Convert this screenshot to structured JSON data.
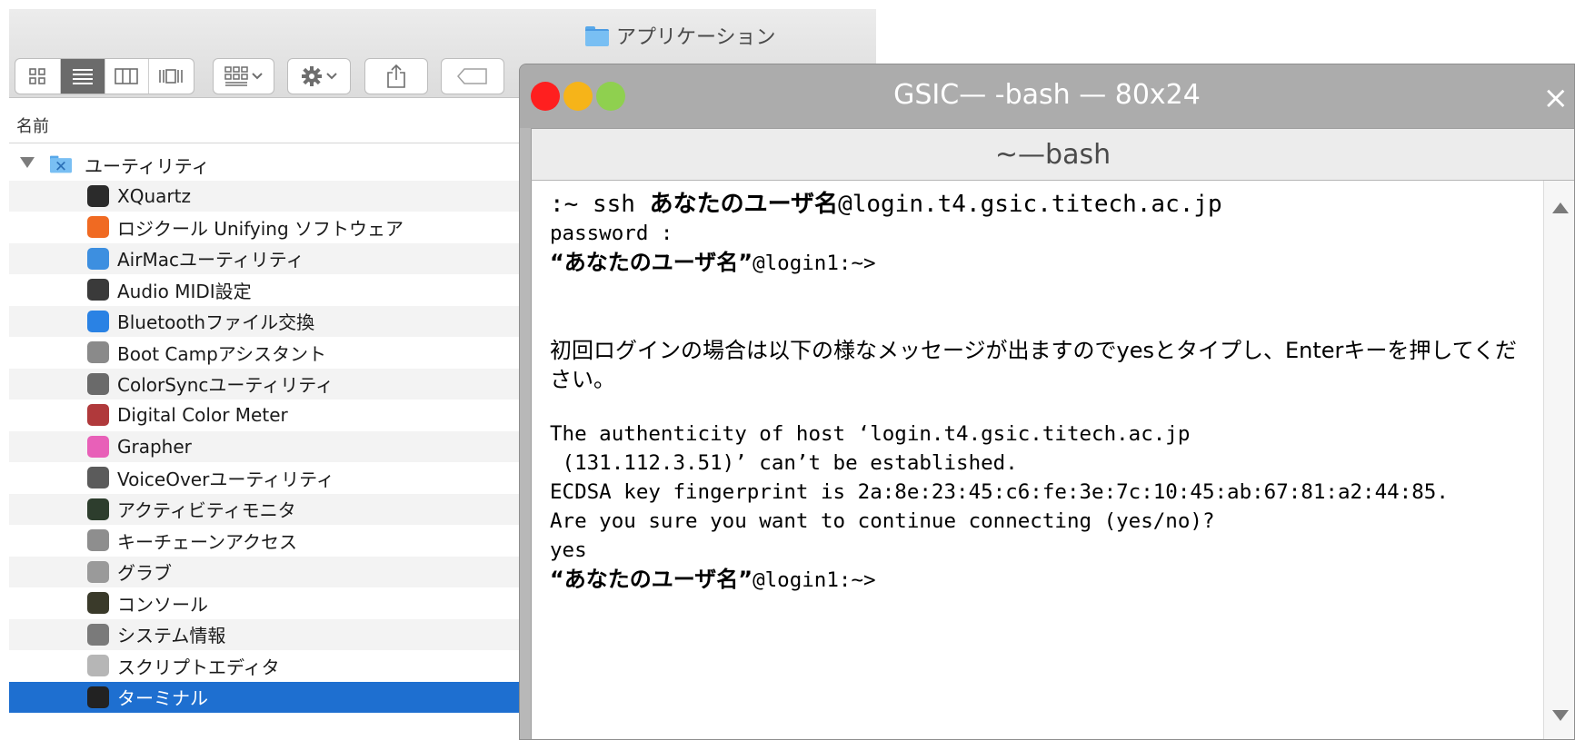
{
  "finder": {
    "title": "アプリケーション",
    "column_header": "名前",
    "toolbar": {
      "view_icon": "grid-icon",
      "view_list": "list-icon",
      "view_columns": "columns-icon",
      "view_coverflow": "coverflow-icon",
      "arrange": "arrange-icon",
      "action": "gear-icon",
      "share": "share-icon",
      "tags": "tag-icon"
    },
    "folder": {
      "name": "ユーティリティ",
      "expanded": true
    },
    "items": [
      {
        "name": "XQuartz",
        "icon": "xquartz-icon",
        "color": "#2b2b2b"
      },
      {
        "name": "ロジクール Unifying ソフトウェア",
        "icon": "logitech-unifying-icon",
        "color": "#f06a22"
      },
      {
        "name": "AirMacユーティリティ",
        "icon": "wifi-icon",
        "color": "#3d8fe0"
      },
      {
        "name": "Audio MIDI設定",
        "icon": "piano-keyboard-icon",
        "color": "#3a3a3a"
      },
      {
        "name": "Bluetoothファイル交換",
        "icon": "bluetooth-icon",
        "color": "#2a82e4"
      },
      {
        "name": "Boot Campアシスタント",
        "icon": "bootcamp-disk-icon",
        "color": "#8a8a8a"
      },
      {
        "name": "ColorSyncユーティリティ",
        "icon": "colorsync-tools-icon",
        "color": "#6a6a6a"
      },
      {
        "name": "Digital Color Meter",
        "icon": "color-meter-icon",
        "color": "#b0393b"
      },
      {
        "name": "Grapher",
        "icon": "grapher-icon",
        "color": "#e860b8"
      },
      {
        "name": "VoiceOverユーティリティ",
        "icon": "voiceover-icon",
        "color": "#5b5b5b"
      },
      {
        "name": "アクティビティモニタ",
        "icon": "activity-monitor-icon",
        "color": "#2d3d2d"
      },
      {
        "name": "キーチェーンアクセス",
        "icon": "keychain-icon",
        "color": "#8e8e8e"
      },
      {
        "name": "グラブ",
        "icon": "grab-icon",
        "color": "#9a9a9a"
      },
      {
        "name": "コンソール",
        "icon": "console-icon",
        "color": "#3a3a2a"
      },
      {
        "name": "システム情報",
        "icon": "system-information-icon",
        "color": "#7a7a7a"
      },
      {
        "name": "スクリプトエディタ",
        "icon": "script-editor-icon",
        "color": "#b6b6b6"
      },
      {
        "name": "ターミナル",
        "icon": "terminal-icon",
        "color": "#222222",
        "selected": true
      }
    ],
    "selection_color": "#1e6fd0"
  },
  "terminal": {
    "title": "GSIC— -bash — 80x24",
    "tab_label": "~—bash",
    "close_glyph": "×",
    "lines": {
      "l1_prefix": ":~ ssh ",
      "l1_user": "あなたのユーザ名",
      "l1_suffix": "@login.t4.gsic.titech.ac.jp",
      "l2": "password :",
      "l3_user": "“あなたのユーザ名”",
      "l3_suffix": "@login1:~>",
      "note": "初回ログインの場合は以下の様なメッセージが出ますのでyesとタイプし、Enterキーを押してください。",
      "msg1": "The authenticity of host ‘login.t4.gsic.titech.ac.jp",
      "msg2": " (131.112.3.51)’ can’t be established.",
      "msg3": "ECDSA key fingerprint is 2a:8e:23:45:c6:fe:3e:7c:10:45:ab:67:81:a2:44:85.",
      "msg4": "Are you sure you want to continue connecting (yes/no)?",
      "msg5": "yes",
      "l6_user": "“あなたのユーザ名”",
      "l6_suffix": "@login1:~>"
    },
    "traffic_lights": {
      "close": "#ff1f1f",
      "minimize": "#f6b419",
      "zoom": "#8fd04f"
    }
  }
}
